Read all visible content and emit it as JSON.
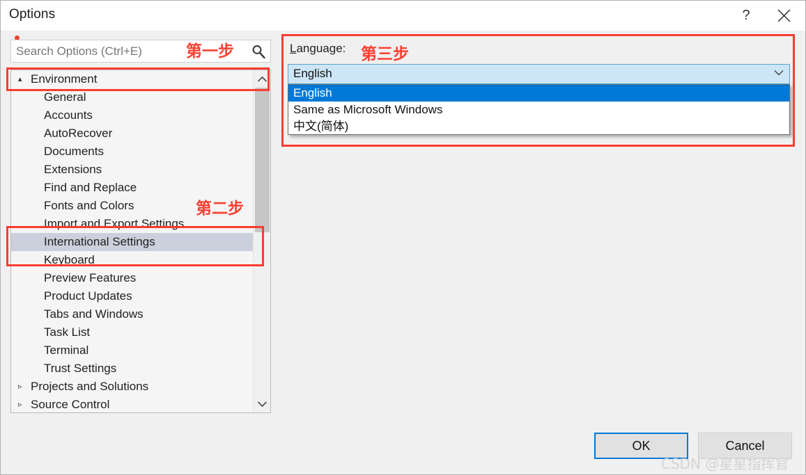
{
  "window": {
    "title": "Options",
    "help_label": "?",
    "close_label": "close-icon"
  },
  "search": {
    "placeholder": "Search Options (Ctrl+E)",
    "value": "",
    "icon": "magnifier-icon"
  },
  "tree": {
    "scroll_up_icon": "chevron-up-icon",
    "scroll_down_icon": "chevron-down-icon",
    "expanded_marker": "▴",
    "collapsed_marker": "▹",
    "items": [
      {
        "label": "Environment",
        "level": 0,
        "state": "expanded",
        "selected": false
      },
      {
        "label": "General",
        "level": 1,
        "state": "leaf",
        "selected": false
      },
      {
        "label": "Accounts",
        "level": 1,
        "state": "leaf",
        "selected": false
      },
      {
        "label": "AutoRecover",
        "level": 1,
        "state": "leaf",
        "selected": false
      },
      {
        "label": "Documents",
        "level": 1,
        "state": "leaf",
        "selected": false
      },
      {
        "label": "Extensions",
        "level": 1,
        "state": "leaf",
        "selected": false
      },
      {
        "label": "Find and Replace",
        "level": 1,
        "state": "leaf",
        "selected": false
      },
      {
        "label": "Fonts and Colors",
        "level": 1,
        "state": "leaf",
        "selected": false
      },
      {
        "label": "Import and Export Settings",
        "level": 1,
        "state": "leaf",
        "selected": false
      },
      {
        "label": "International Settings",
        "level": 1,
        "state": "leaf",
        "selected": true
      },
      {
        "label": "Keyboard",
        "level": 1,
        "state": "leaf",
        "selected": false
      },
      {
        "label": "Preview Features",
        "level": 1,
        "state": "leaf",
        "selected": false
      },
      {
        "label": "Product Updates",
        "level": 1,
        "state": "leaf",
        "selected": false
      },
      {
        "label": "Tabs and Windows",
        "level": 1,
        "state": "leaf",
        "selected": false
      },
      {
        "label": "Task List",
        "level": 1,
        "state": "leaf",
        "selected": false
      },
      {
        "label": "Terminal",
        "level": 1,
        "state": "leaf",
        "selected": false
      },
      {
        "label": "Trust Settings",
        "level": 1,
        "state": "leaf",
        "selected": false
      },
      {
        "label": "Projects and Solutions",
        "level": 0,
        "state": "collapsed",
        "selected": false
      },
      {
        "label": "Source Control",
        "level": 0,
        "state": "collapsed",
        "selected": false
      }
    ]
  },
  "language": {
    "label": "Language:",
    "label_accelerator": "L",
    "label_rest": "anguage:",
    "selected_value": "English",
    "dropdown_arrow_icon": "chevron-down-icon",
    "options": [
      {
        "label": "English",
        "highlighted": true
      },
      {
        "label": "Same as Microsoft Windows",
        "highlighted": false
      },
      {
        "label": "中文(简体)",
        "highlighted": false
      }
    ]
  },
  "annotations": {
    "step1": "第一步",
    "step2": "第二步",
    "step3": "第三步",
    "color": "#fa4032"
  },
  "footer": {
    "ok_label": "OK",
    "cancel_label": "Cancel"
  },
  "watermark": {
    "text": "CSDN @星星指挥官"
  }
}
